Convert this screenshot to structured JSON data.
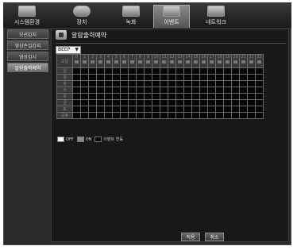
{
  "menu": {
    "tabs": [
      {
        "label": "시스템환경",
        "icon": "monitor-icon"
      },
      {
        "label": "장치",
        "icon": "camera-icon"
      },
      {
        "label": "녹화",
        "icon": "record-icon"
      },
      {
        "label": "이벤트",
        "icon": "event-icon"
      },
      {
        "label": "네트워크",
        "icon": "network-icon"
      }
    ],
    "active_tab": "이벤트"
  },
  "sidebar": {
    "items": [
      {
        "label": "모션감지"
      },
      {
        "label": "영상손실감지"
      },
      {
        "label": "영상감시"
      },
      {
        "label": "알람출력예약"
      }
    ],
    "active_item": "알람출력예약"
  },
  "page": {
    "title": "알람출력예약",
    "output_select": "BEEP"
  },
  "schedule": {
    "corner_label": "요일",
    "hours": [
      "0",
      "1",
      "2",
      "3",
      "4",
      "5",
      "6",
      "7",
      "8",
      "9",
      "10",
      "11",
      "12",
      "13",
      "14",
      "15",
      "16",
      "17",
      "18",
      "19",
      "20",
      "21",
      "22",
      "23"
    ],
    "days": [
      "일",
      "월",
      "화",
      "수",
      "목",
      "금",
      "토",
      "공휴"
    ]
  },
  "legend": {
    "off": "OFF",
    "on": "ON",
    "event": "이벤트 연동"
  },
  "buttons": {
    "apply": "적용",
    "cancel": "취소"
  }
}
